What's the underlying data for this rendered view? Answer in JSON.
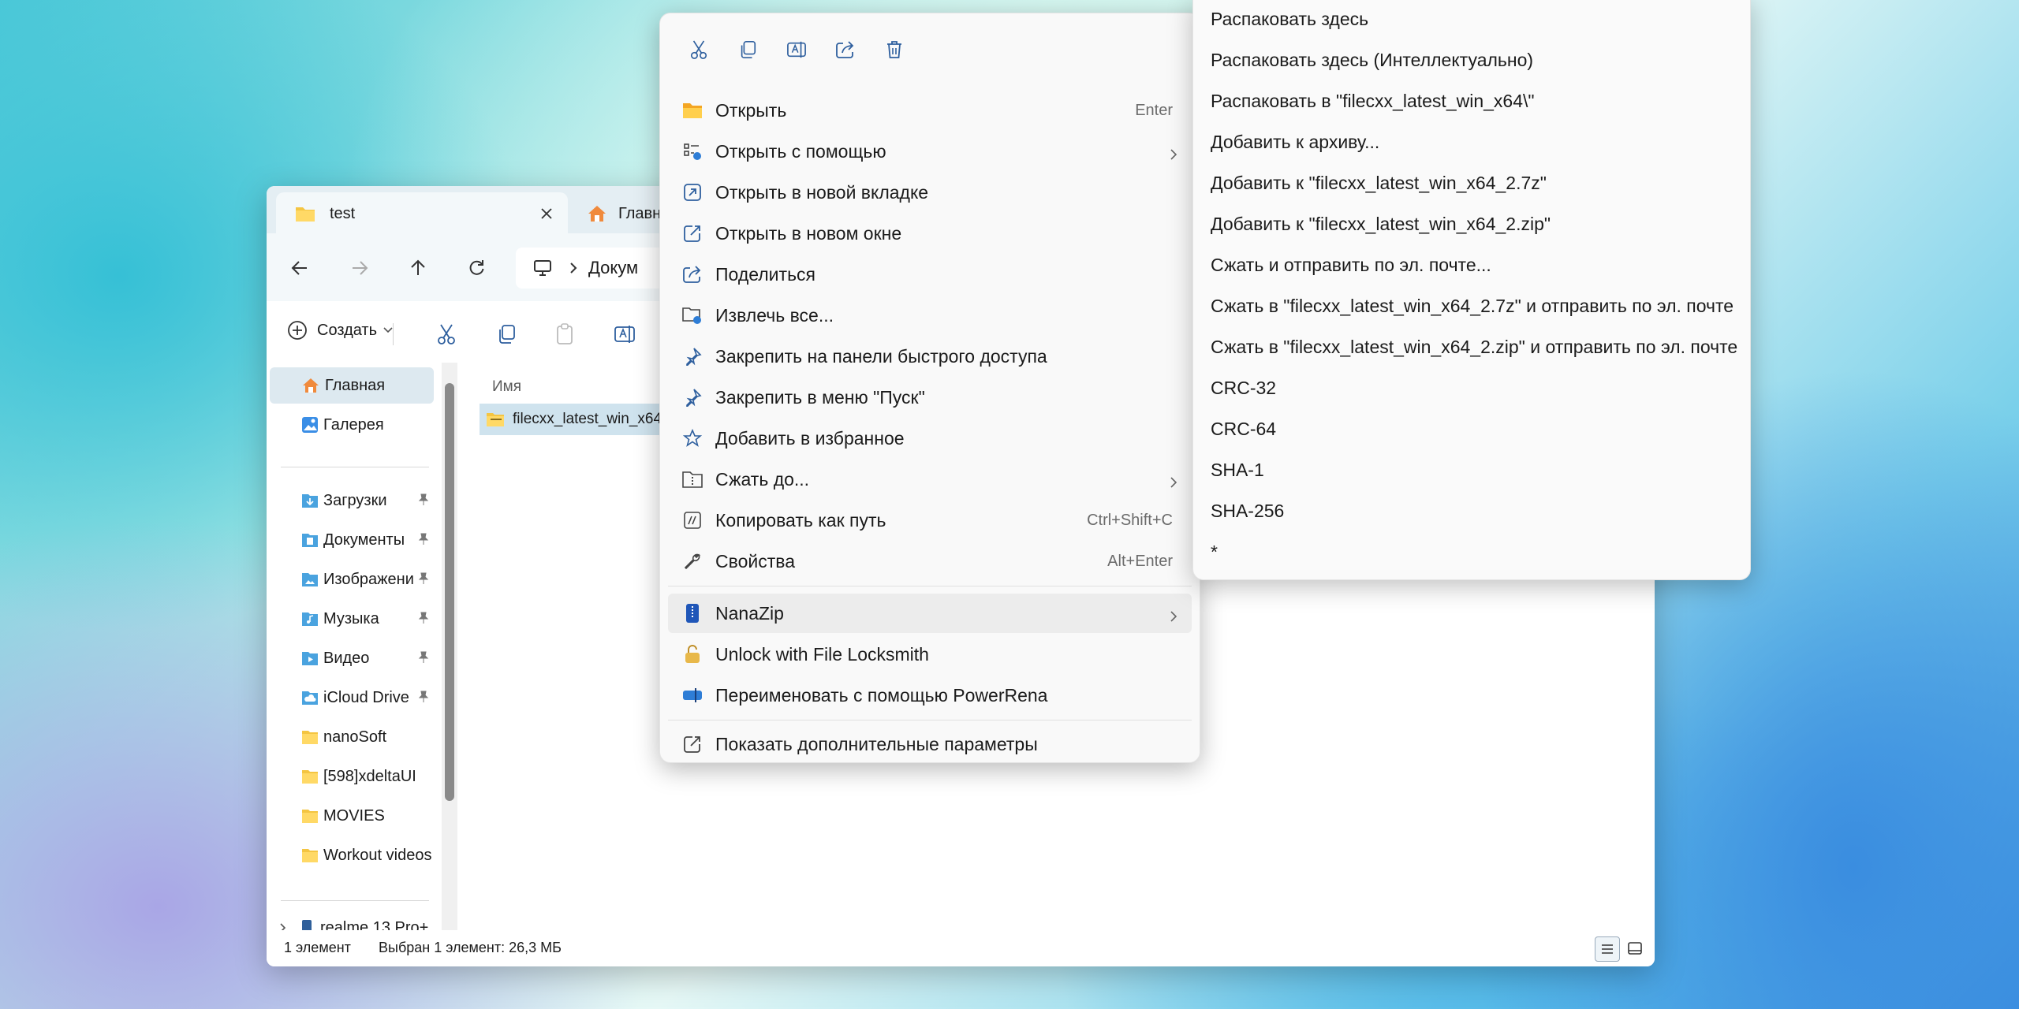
{
  "explorer": {
    "tabs": [
      {
        "label": "test"
      },
      {
        "label": "Главн"
      }
    ],
    "address": {
      "segment": "Докум"
    },
    "toolbar": {
      "create_label": "Создать"
    },
    "sidebar": {
      "home": "Главная",
      "gallery": "Галерея",
      "pinned": [
        "Загрузки",
        "Документы",
        "Изображени",
        "Музыка",
        "Видео",
        "iCloud Drive"
      ],
      "folders": [
        "nanoSoft",
        "[598]xdeltaUI",
        "MOVIES",
        "Workout videos"
      ],
      "device": "realme 13 Pro+"
    },
    "content": {
      "column_name": "Имя",
      "file_name": "filecxx_latest_win_x64"
    },
    "status": {
      "count": "1 элемент",
      "selected": "Выбран 1 элемент: 26,3 МБ"
    }
  },
  "context_menu": {
    "items": [
      {
        "label": "Открыть",
        "shortcut": "Enter"
      },
      {
        "label": "Открыть с помощью"
      },
      {
        "label": "Открыть в новой вкладке"
      },
      {
        "label": "Открыть в новом окне"
      },
      {
        "label": "Поделиться"
      },
      {
        "label": "Извлечь все..."
      },
      {
        "label": "Закрепить на панели быстрого доступа"
      },
      {
        "label": "Закрепить в меню \"Пуск\""
      },
      {
        "label": "Добавить в избранное"
      },
      {
        "label": "Сжать до..."
      },
      {
        "label": "Копировать как путь",
        "shortcut": "Ctrl+Shift+C"
      },
      {
        "label": "Свойства",
        "shortcut": "Alt+Enter"
      }
    ],
    "extras": [
      {
        "label": "NanaZip"
      },
      {
        "label": "Unlock with File Locksmith"
      },
      {
        "label": "Переименовать с помощью PowerRena"
      }
    ],
    "more": "Показать дополнительные параметры"
  },
  "submenu": {
    "items": [
      "Распаковать здесь",
      "Распаковать здесь (Интеллектуально)",
      "Распаковать в \"filecxx_latest_win_x64\\\"",
      "Добавить к архиву...",
      "Добавить к \"filecxx_latest_win_x64_2.7z\"",
      "Добавить к \"filecxx_latest_win_x64_2.zip\"",
      "Сжать и отправить по эл. почте...",
      "Сжать в \"filecxx_latest_win_x64_2.7z\" и отправить по эл. почте",
      "Сжать в \"filecxx_latest_win_x64_2.zip\" и отправить по эл. почте",
      "CRC-32",
      "CRC-64",
      "SHA-1",
      "SHA-256",
      "*"
    ]
  },
  "colors": {
    "accent": "#0067c0",
    "folder": "#f4c542",
    "highlight": "#ececec"
  }
}
